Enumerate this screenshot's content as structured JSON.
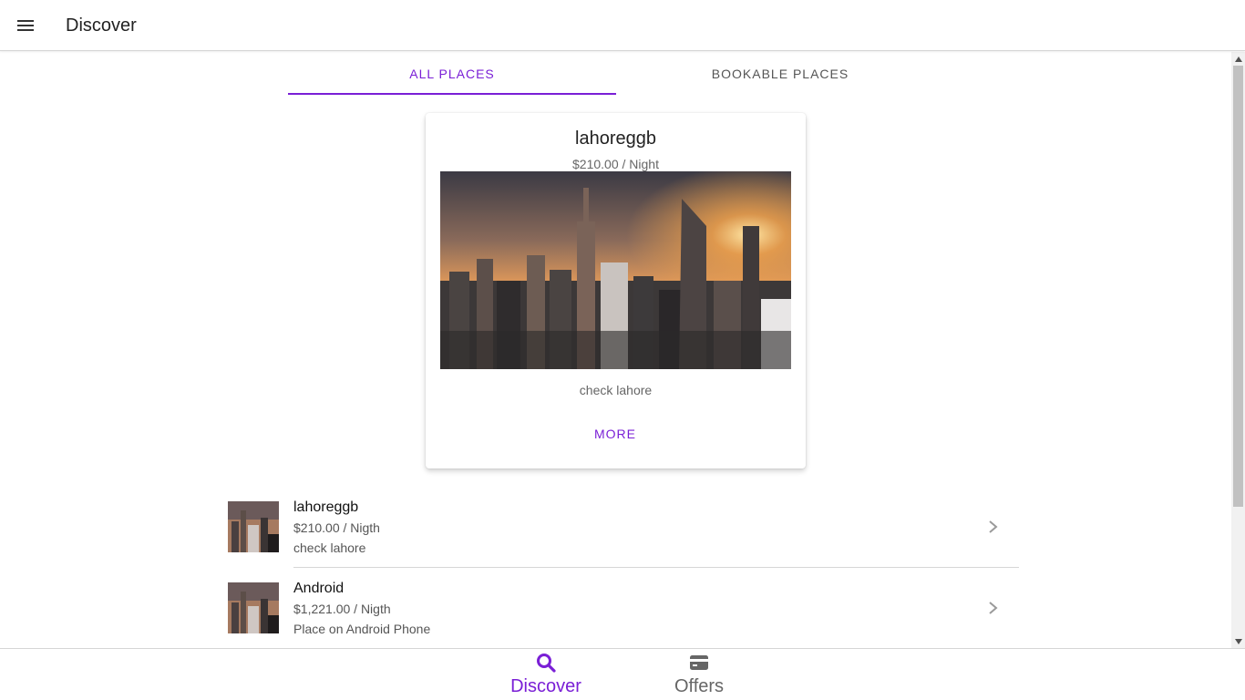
{
  "header": {
    "title": "Discover",
    "menu_icon": "menu-icon"
  },
  "segment": {
    "tabs": [
      {
        "label": "ALL PLACES",
        "active": true
      },
      {
        "label": "BOOKABLE PLACES",
        "active": false
      }
    ]
  },
  "featured": {
    "title": "lahoreggb",
    "subtitle": "$210.00 / Night",
    "description": "check lahore",
    "more_label": "MORE"
  },
  "places": [
    {
      "title": "lahoreggb",
      "price": "$210.00 / Nigth",
      "description": "check lahore"
    },
    {
      "title": "Android",
      "price": "$1,221.00 / Nigth",
      "description": "Place on Android Phone"
    }
  ],
  "tabbar": {
    "items": [
      {
        "label": "Discover",
        "icon": "search-icon",
        "active": true
      },
      {
        "label": "Offers",
        "icon": "card-icon",
        "active": false
      }
    ]
  },
  "colors": {
    "accent": "#7a1fd6",
    "text": "#222222",
    "muted": "#666666",
    "divider": "#d6d6d6"
  }
}
